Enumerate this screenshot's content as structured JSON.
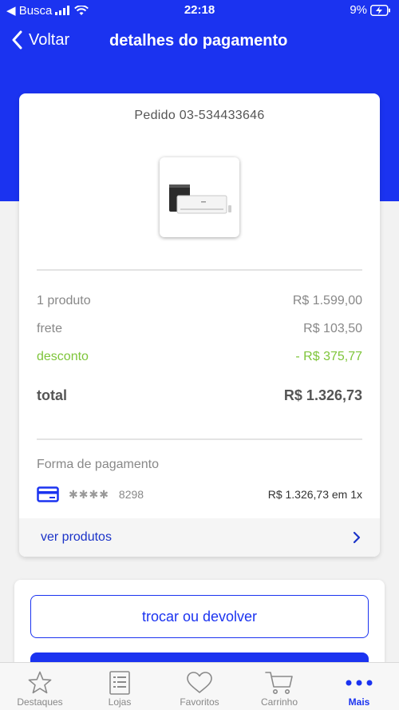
{
  "status_bar": {
    "carrier": "◀ Busca",
    "time": "22:18",
    "battery": "9%"
  },
  "nav": {
    "back_label": "Voltar",
    "title": "detalhes do pagamento"
  },
  "order": {
    "number": "Pedido 03-534433646"
  },
  "summary": {
    "products_label": "1 produto",
    "products_value": "R$ 1.599,00",
    "shipping_label": "frete",
    "shipping_value": "R$ 103,50",
    "discount_label": "desconto",
    "discount_value": "- R$ 375,77",
    "total_label": "total",
    "total_value": "R$ 1.326,73"
  },
  "payment": {
    "label": "Forma de pagamento",
    "card_mask": "✱✱✱✱",
    "card_last": "8298",
    "amount": "R$ 1.326,73 em 1x"
  },
  "see_products_label": "ver produtos",
  "actions": {
    "exchange_label": "trocar ou devolver"
  },
  "tabbar": [
    {
      "label": "Destaques",
      "icon": "star-icon"
    },
    {
      "label": "Lojas",
      "icon": "list-icon"
    },
    {
      "label": "Favoritos",
      "icon": "heart-icon"
    },
    {
      "label": "Carrinho",
      "icon": "cart-icon"
    },
    {
      "label": "Mais",
      "icon": "more-icon"
    }
  ],
  "colors": {
    "primary": "#1b33f0",
    "discount": "#7ec53a"
  }
}
